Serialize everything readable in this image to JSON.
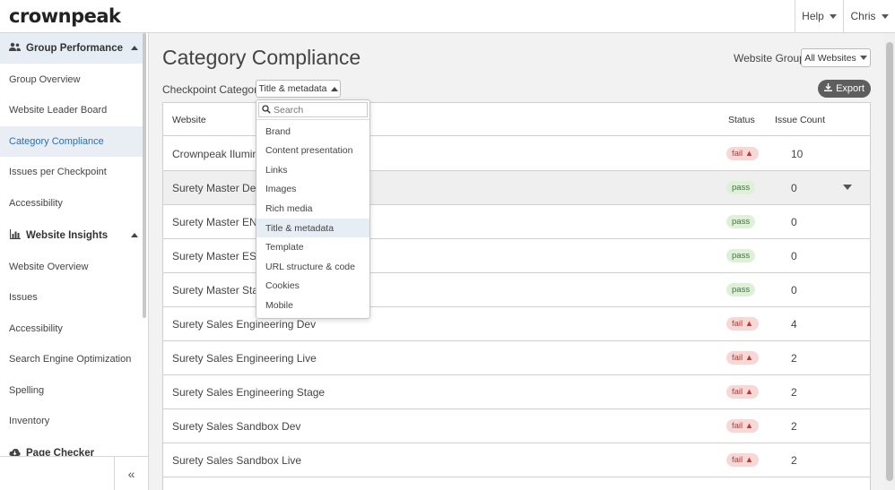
{
  "brand": {
    "logo": "crownpeak"
  },
  "topnav": {
    "help": "Help",
    "user": "Chris"
  },
  "sidebar": {
    "sections": [
      {
        "label": "Group Performance",
        "icon": "users-icon"
      },
      {
        "label": "Website Insights",
        "icon": "chart-icon"
      },
      {
        "label": "Page Checker",
        "icon": "cloud-download-icon"
      }
    ],
    "group_items": [
      "Group Overview",
      "Website Leader Board",
      "Category Compliance",
      "Issues per Checkpoint",
      "Accessibility"
    ],
    "insight_items": [
      "Website Overview",
      "Issues",
      "Accessibility",
      "Search Engine Optimization",
      "Spelling",
      "Inventory"
    ],
    "collapse": "«"
  },
  "main": {
    "title": "Category Compliance",
    "website_group_label": "Website Group:",
    "website_group_value": "All Websites",
    "checkpoint_label": "Checkpoint Category:",
    "checkpoint_value": "Title & metadata",
    "export_label": "Export"
  },
  "dropdown": {
    "search_placeholder": "Search",
    "options": [
      "Brand",
      "Content presentation",
      "Links",
      "Images",
      "Rich media",
      "Title & metadata",
      "Template",
      "URL structure & code",
      "Cookies",
      "Mobile"
    ],
    "selected": "Title & metadata"
  },
  "table": {
    "headers": {
      "website": "Website",
      "status": "Status",
      "issues": "Issue Count"
    },
    "rows": [
      {
        "name": "Crownpeak Ilumino",
        "status": "fail",
        "count": "10"
      },
      {
        "name": "Surety Master Dev",
        "status": "pass",
        "count": "0"
      },
      {
        "name": "Surety Master EN",
        "status": "pass",
        "count": "0"
      },
      {
        "name": "Surety Master ES",
        "status": "pass",
        "count": "0"
      },
      {
        "name": "Surety Master Stage",
        "status": "pass",
        "count": "0"
      },
      {
        "name": "Surety Sales Engineering Dev",
        "status": "fail",
        "count": "4"
      },
      {
        "name": "Surety Sales Engineering Live",
        "status": "fail",
        "count": "2"
      },
      {
        "name": "Surety Sales Engineering Stage",
        "status": "fail",
        "count": "2"
      },
      {
        "name": "Surety Sales Sandbox Dev",
        "status": "fail",
        "count": "2"
      },
      {
        "name": "Surety Sales Sandbox Live",
        "status": "fail",
        "count": "2"
      }
    ],
    "badge_labels": {
      "fail": "fail ▲",
      "pass": "pass"
    }
  },
  "colors": {
    "accent": "#2c6fb2",
    "brand_pink": "#e6007e",
    "fail": "#c0392b",
    "pass": "#3c763d"
  }
}
